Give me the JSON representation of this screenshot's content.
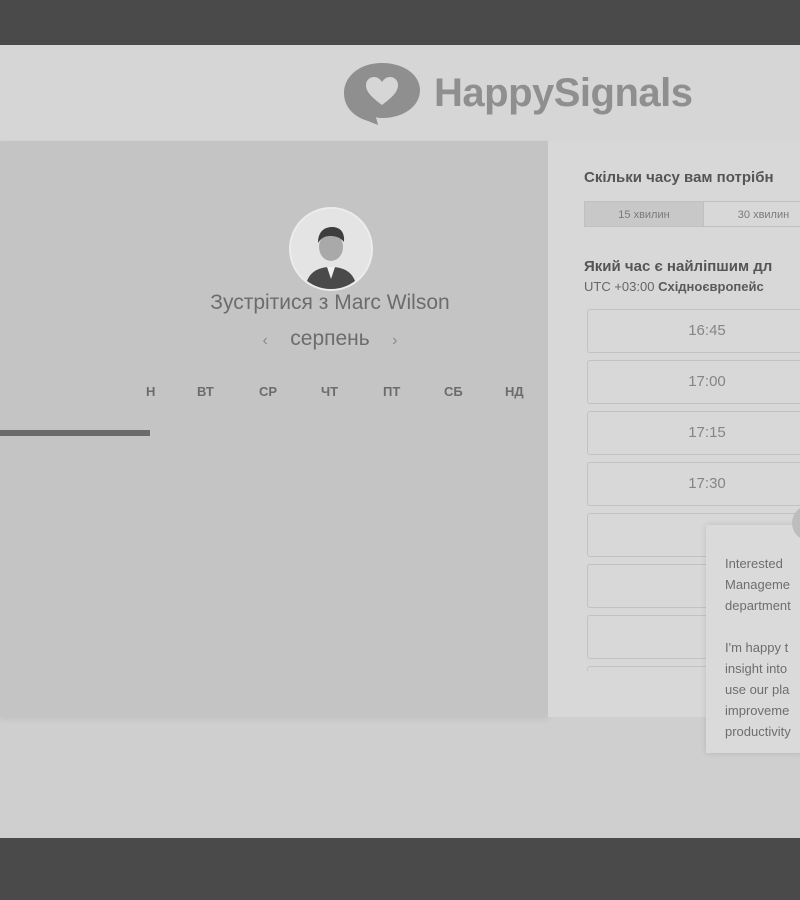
{
  "brand": {
    "name": "HappySignals"
  },
  "calendar": {
    "title": "Зустрітися з Marc Wilson",
    "month": "серпень",
    "prev_icon": "‹",
    "next_icon": "›",
    "weekdays": [
      "Н",
      "ВТ",
      "СР",
      "ЧТ",
      "ПТ",
      "СБ",
      "НД"
    ]
  },
  "booking": {
    "duration_question": "Скільки часу вам потрібн",
    "durations": [
      "15 хвилин",
      "30 хвилин"
    ],
    "selected_duration": "15 хвилин",
    "time_question": "Який час є найліпшим дл",
    "timezone_offset": "UTC +03:00",
    "timezone_name": "Східноєвропейс",
    "slots": [
      "16:45",
      "17:00",
      "17:15",
      "17:30",
      "",
      "",
      "",
      ""
    ]
  },
  "chat_popup": {
    "text": "Interested \nManageme\ndepartment\n\nI'm happy t\ninsight into\nuse our pla\nimproveme\nproductivity"
  },
  "colors": {
    "page_background": "#cfcfcf",
    "frame": "#4a4a4a",
    "logo_gray": "#8f8f8f"
  }
}
